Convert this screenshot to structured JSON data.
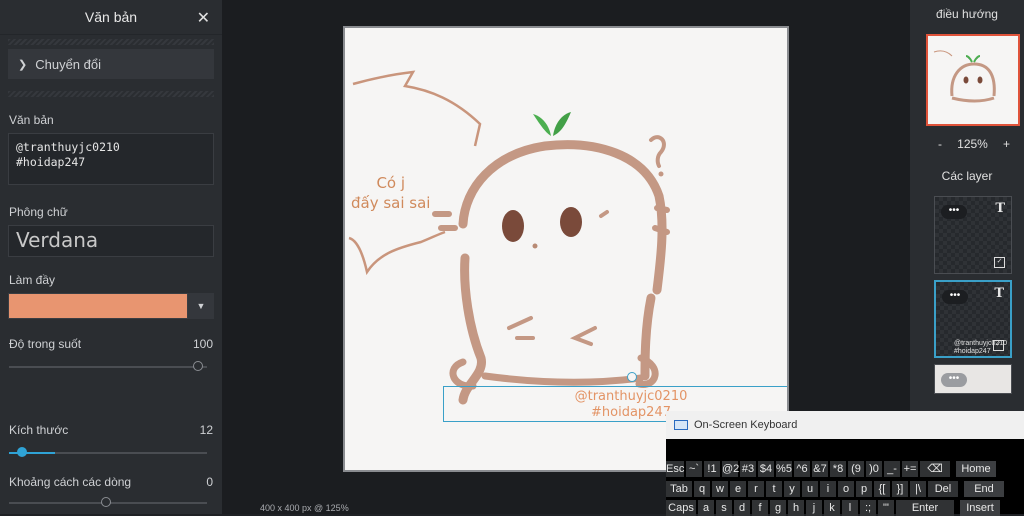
{
  "left_panel": {
    "title": "Văn bản",
    "convert_label": "Chuyển đổi",
    "text_label": "Văn bản",
    "text_value": "@tranthuyjc0210\n#hoidap247",
    "font_label": "Phông chữ",
    "font_value": "Verdana",
    "fill_label": "Làm đầy",
    "fill_color": "#e89570",
    "opacity_label": "Độ trong suốt",
    "opacity_value": "100",
    "size_label": "Kích thước",
    "size_value": "12",
    "line_spacing_label": "Khoảng cách các dòng",
    "line_spacing_value": "0"
  },
  "canvas": {
    "speech_text": "Có j\nđấy sai sai",
    "overlay_text": "@tranthuyjc0210\n#hoidap247",
    "status": "400 x 400 px @ 125%"
  },
  "right_panel": {
    "nav_title": "điều hướng",
    "zoom_value": "125%",
    "zoom_minus": "-",
    "zoom_plus": "+",
    "layers_title": "Các layer",
    "layer_preview_text": "@tranthuyjc0210\n#hoidap247"
  },
  "osk": {
    "title": "On-Screen Keyboard",
    "row1": [
      "Esc",
      "~`",
      "!1",
      "@2",
      "#3",
      "$4",
      "%5",
      "^6",
      "&7",
      "*8",
      "(9",
      ")0",
      "_-",
      "+=",
      "⌫",
      "Home"
    ],
    "row2": [
      "Tab",
      "q",
      "w",
      "e",
      "r",
      "t",
      "y",
      "u",
      "i",
      "o",
      "p",
      "{[",
      "}]",
      "|\\",
      "Del",
      "End"
    ],
    "row3": [
      "Caps",
      "a",
      "s",
      "d",
      "f",
      "g",
      "h",
      "j",
      "k",
      "l",
      ":;",
      "\"'",
      "Enter",
      "Insert"
    ]
  },
  "colors": {
    "accent": "#3aa0c8",
    "nav_border": "#e0533a",
    "text_fill": "#e89570"
  }
}
